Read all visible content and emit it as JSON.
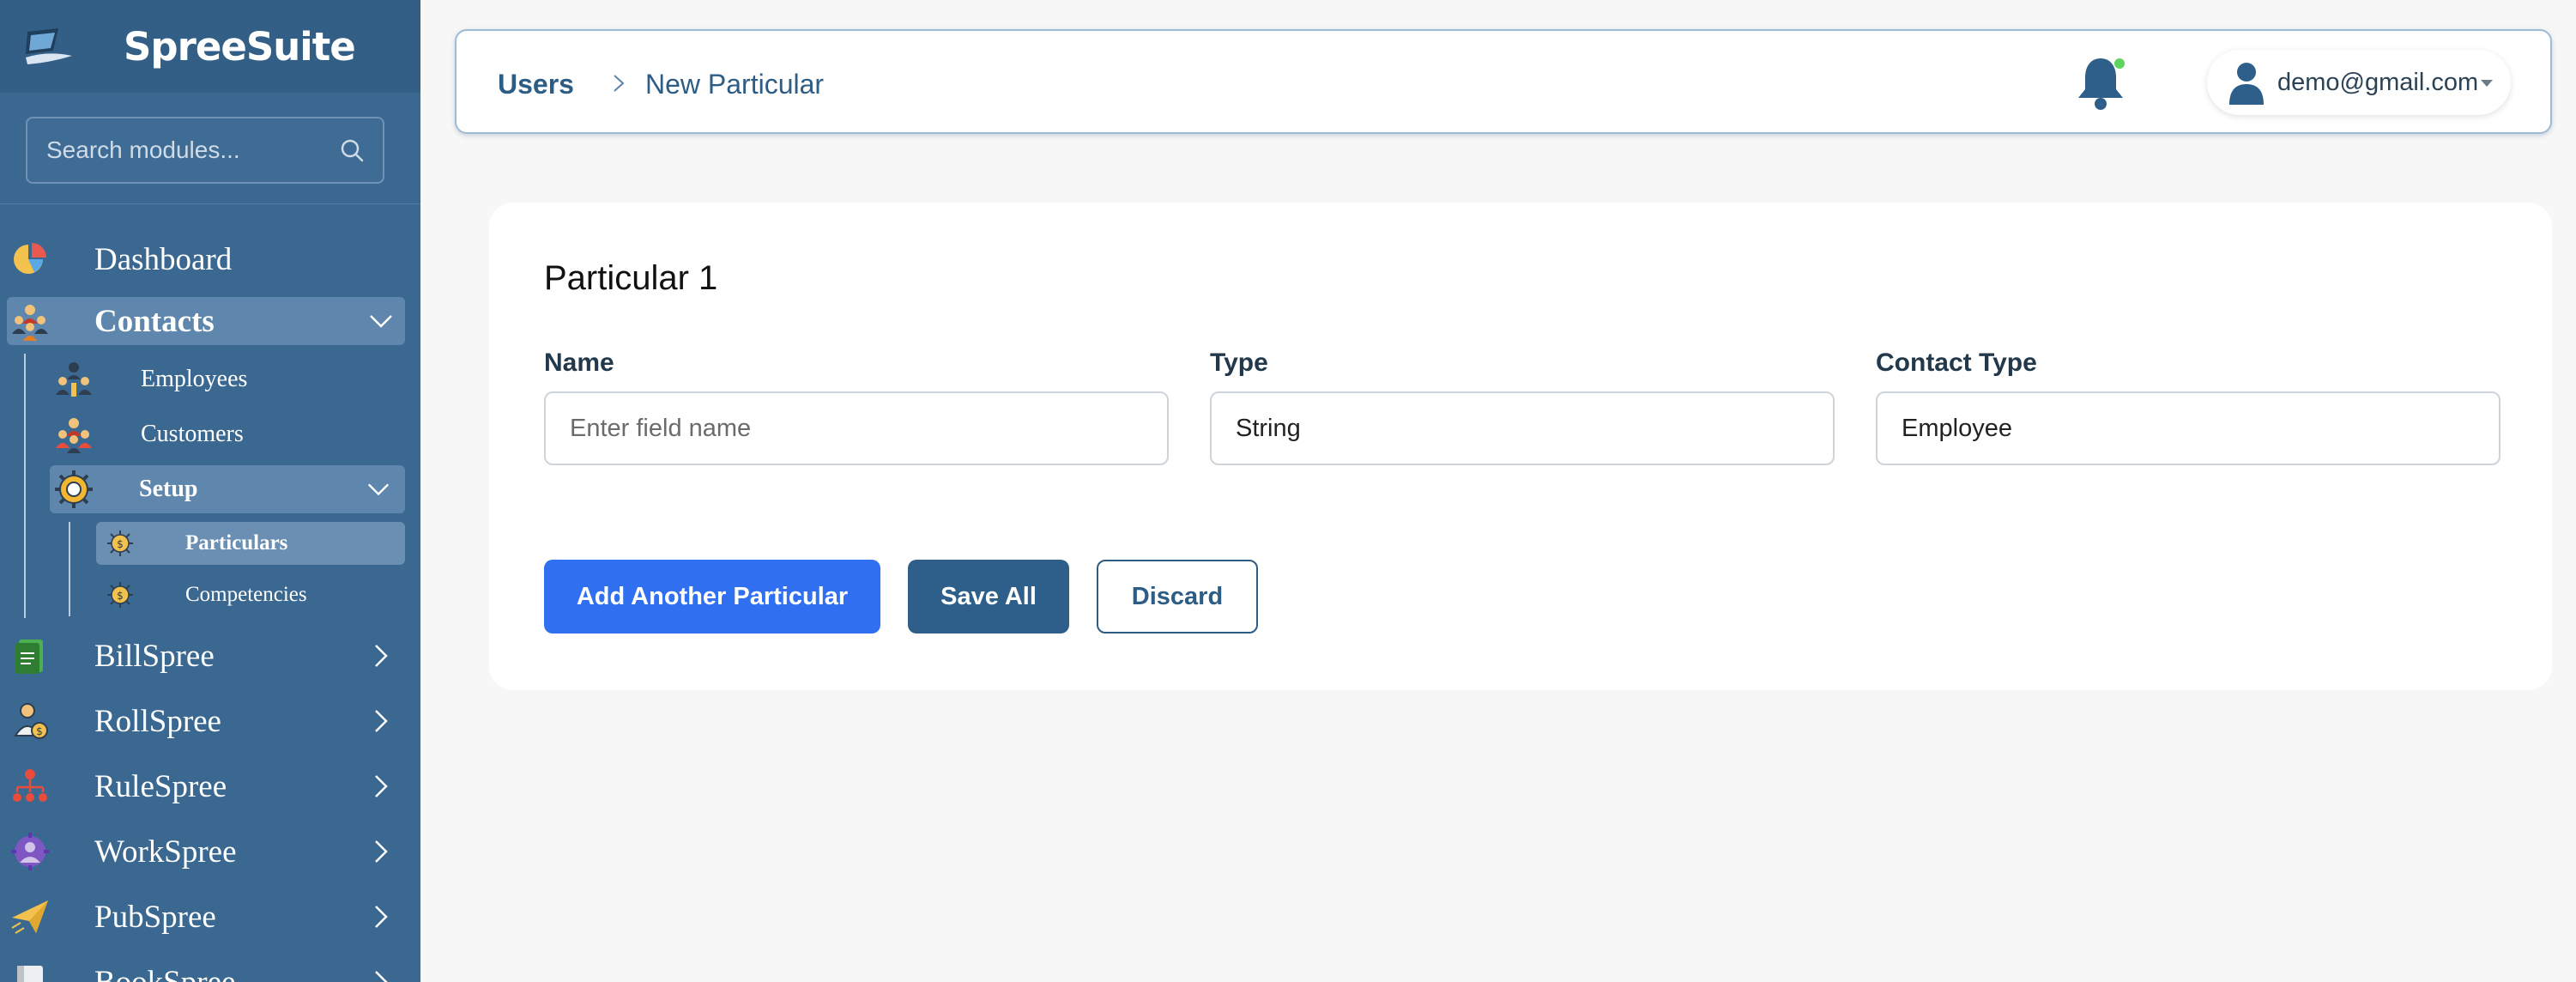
{
  "app": {
    "name": "SpreeSuite",
    "colors": {
      "sidebar": "#3b6891",
      "accent": "#2f6ff0",
      "navy": "#2e5f8a",
      "online_dot": "#5fd35f"
    }
  },
  "sidebar": {
    "search_placeholder": "Search modules...",
    "items": [
      {
        "label": "Dashboard",
        "icon": "pie-chart-icon"
      },
      {
        "label": "Contacts",
        "icon": "people-group-icon",
        "expanded": true
      },
      {
        "label": "BillSpree",
        "icon": "bill-document-icon"
      },
      {
        "label": "RollSpree",
        "icon": "payroll-person-icon"
      },
      {
        "label": "RuleSpree",
        "icon": "hierarchy-icon"
      },
      {
        "label": "WorkSpree",
        "icon": "work-gear-icon"
      },
      {
        "label": "PubSpree",
        "icon": "paper-plane-icon"
      },
      {
        "label": "BookSpree",
        "icon": "book-icon"
      }
    ],
    "contacts_children": [
      {
        "label": "Employees",
        "icon": "employees-icon"
      },
      {
        "label": "Customers",
        "icon": "customers-icon"
      },
      {
        "label": "Setup",
        "icon": "gear-icon",
        "expanded": true
      }
    ],
    "setup_children": [
      {
        "label": "Particulars",
        "icon": "coin-gear-icon",
        "active": true
      },
      {
        "label": "Competencies",
        "icon": "coin-gear-icon"
      }
    ]
  },
  "header": {
    "breadcrumb_root": "Users",
    "breadcrumb_current": "New Particular",
    "user_email": "demo@gmail.com"
  },
  "form": {
    "title": "Particular 1",
    "fields": {
      "name": {
        "label": "Name",
        "placeholder": "Enter field name",
        "value": ""
      },
      "type": {
        "label": "Type",
        "value": "String"
      },
      "contact_type": {
        "label": "Contact Type",
        "value": "Employee"
      }
    },
    "buttons": {
      "add": "Add Another Particular",
      "save": "Save All",
      "discard": "Discard"
    }
  }
}
